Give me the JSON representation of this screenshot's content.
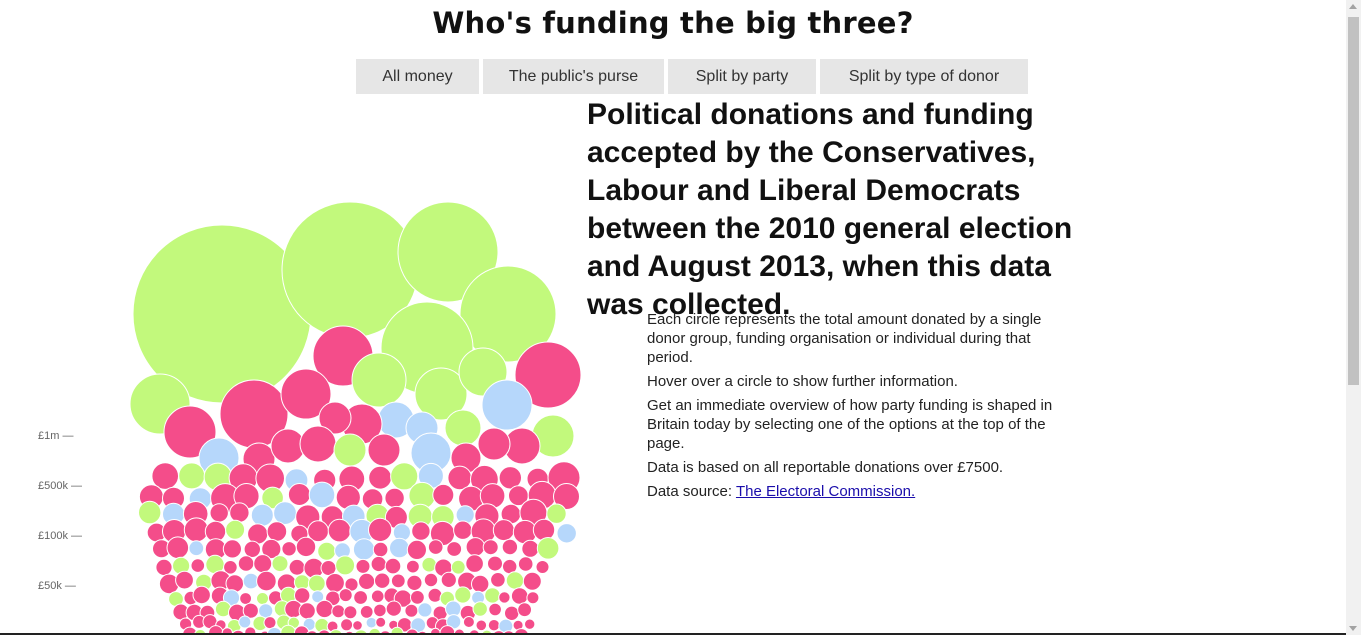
{
  "page": {
    "title": "Who's funding the big three?"
  },
  "tabs": [
    {
      "label": "All money"
    },
    {
      "label": "The public's purse"
    },
    {
      "label": "Split by party"
    },
    {
      "label": "Split by type of donor"
    }
  ],
  "intro": {
    "headline": "Political donations and funding accepted by the Conservatives, Labour and Liberal Democrats between the 2010 general election and August 2013, when this data was collected.",
    "paragraphs": [
      "Each circle represents the total amount donated by a single donor group, funding organisation or individual during that period.",
      "Hover over a circle to show further information.",
      "Get an immediate overview of how party funding is shaped in Britain today by selecting one of the options at the top of the page.",
      "Data is based on all reportable donations over £7500."
    ],
    "source_prefix": "Data source: ",
    "source_link": "The Electoral Commission."
  },
  "scale": [
    {
      "label": "£1m —"
    },
    {
      "label": "£500k —"
    },
    {
      "label": "£100k —"
    },
    {
      "label": "£50k —"
    }
  ],
  "colors": {
    "labour_pink": "#f44d8a",
    "green": "#c2f97c",
    "light_blue": "#b6d7fb"
  }
}
